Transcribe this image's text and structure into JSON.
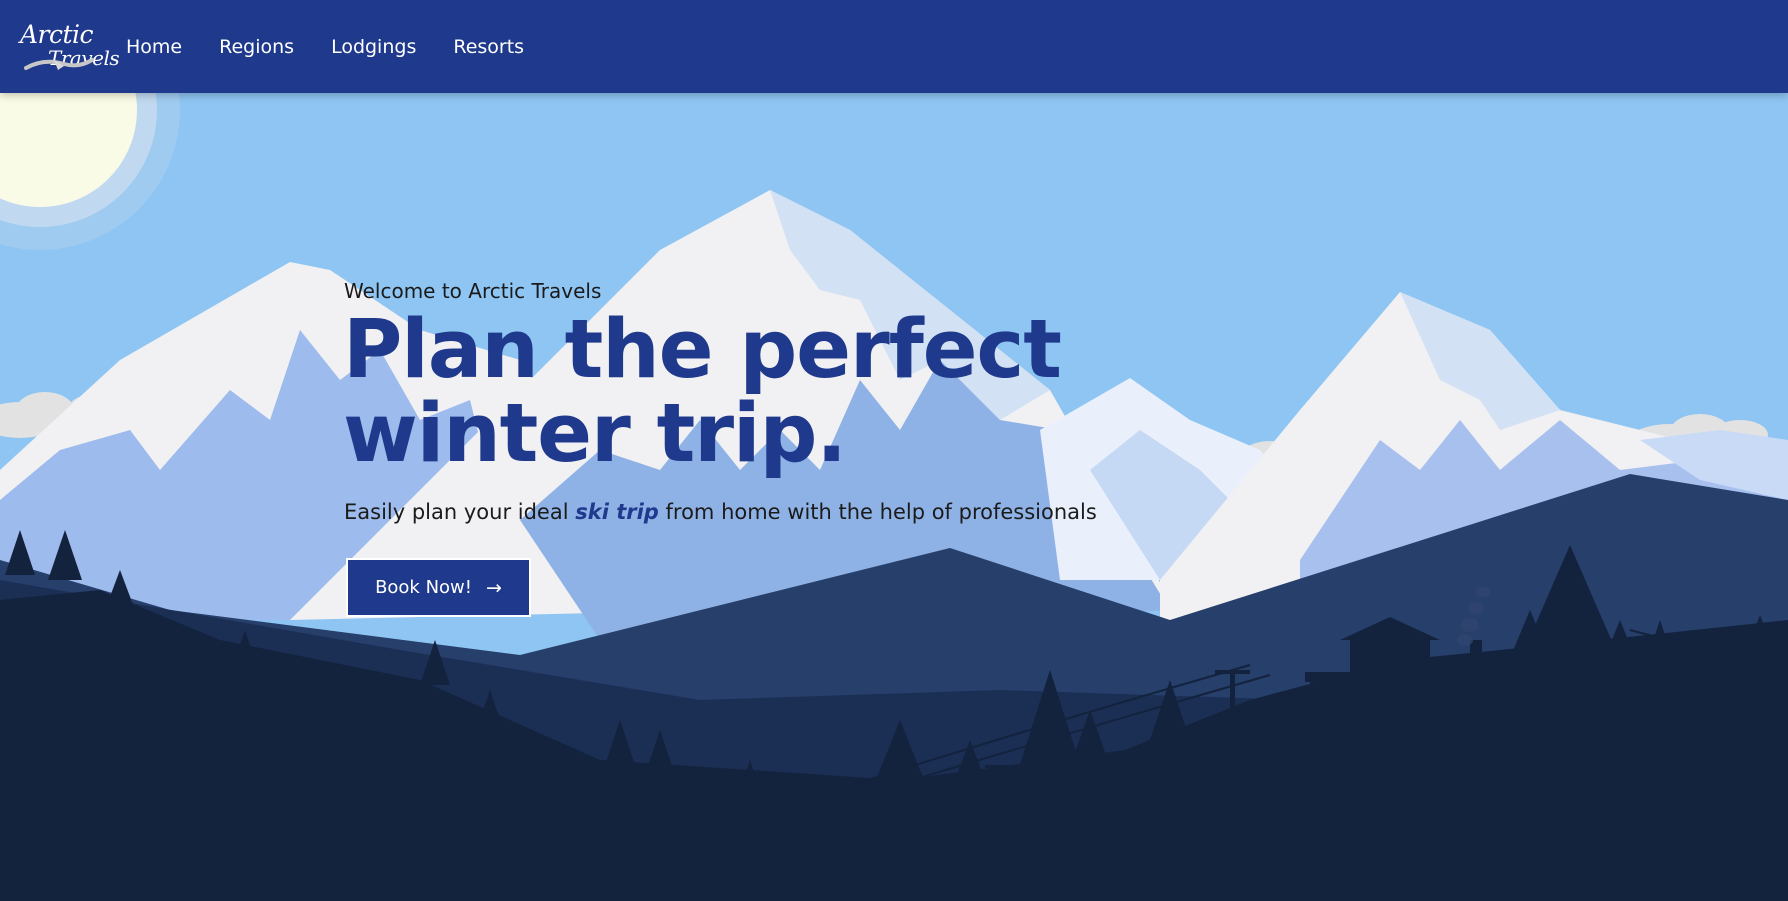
{
  "brand": {
    "logo_line1": "Arctic",
    "logo_line2": "Travels"
  },
  "nav": {
    "items": [
      {
        "label": "Home"
      },
      {
        "label": "Regions"
      },
      {
        "label": "Lodgings"
      },
      {
        "label": "Resorts"
      }
    ]
  },
  "hero": {
    "welcome": "Welcome to Arctic Travels",
    "headline": "Plan the perfect winter trip.",
    "subtitle_before": "Easily plan your ideal ",
    "subtitle_emphasis": "ski trip",
    "subtitle_after": " from home with the help of professionals",
    "cta_label": "Book Now!",
    "cta_icon": "arrow-right-icon"
  },
  "colors": {
    "brand_blue": "#1f3a8c",
    "sky": "#8ec5f2",
    "snow": "#f2f2f4",
    "mountain_shadow": "#8fb2e6",
    "dark_ridge": "#263f6b",
    "forest": "#13223d"
  }
}
